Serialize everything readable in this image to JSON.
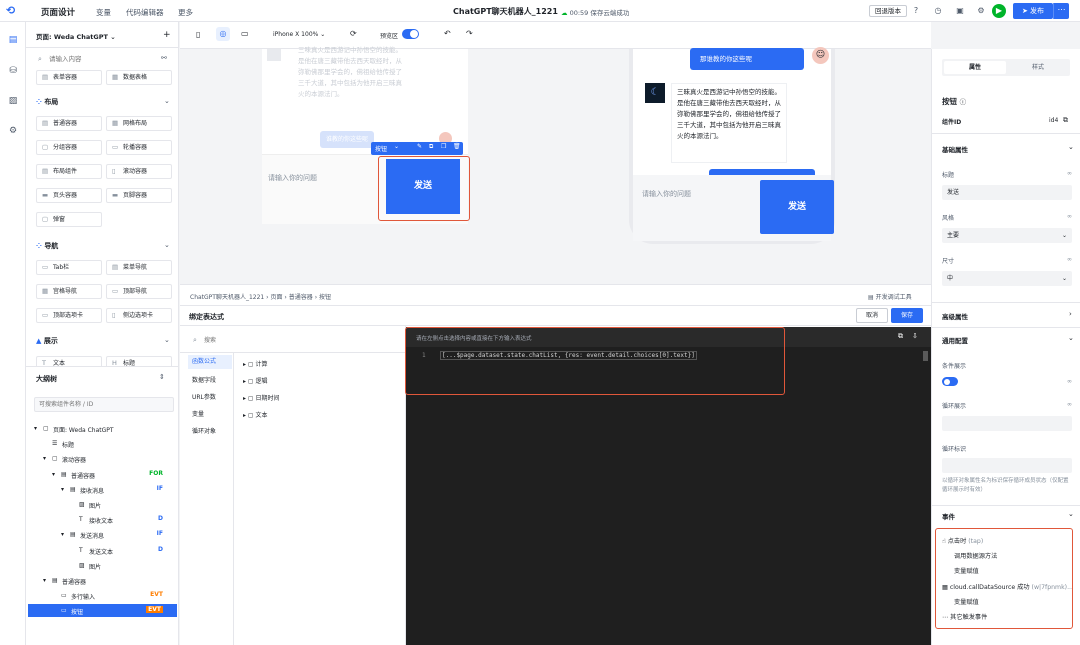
{
  "topbar": {
    "title": "页面设计",
    "nav": [
      "变量",
      "代码编辑器",
      "更多"
    ],
    "doc_title": "ChatGPT聊天机器人_1221",
    "save_status": "00:59 保存云端成功",
    "rollback": "回退版本",
    "publish": "发布"
  },
  "left": {
    "page_select": "页面: Weda ChatGPT",
    "search_placeholder": "请输入内容",
    "group_top": {
      "a": "表单容器",
      "b": "数据表格"
    },
    "layout_title": "布局",
    "layout_items": [
      "普通容器",
      "网格布局",
      "分组容器",
      "轮播容器",
      "布局组件",
      "滚动容器",
      "页头容器",
      "页脚容器",
      "弹窗"
    ],
    "nav_title": "导航",
    "nav_items": [
      "Tab栏",
      "菜单导航",
      "宫格导航",
      "顶部导航",
      "顶部选项卡",
      "侧边选项卡"
    ],
    "display_title": "展示",
    "display_items": [
      "文本",
      "标题"
    ],
    "outline_title": "大纲树",
    "outline_placeholder": "可搜索组件名称 / ID",
    "tree": [
      {
        "label": "页面: Weda ChatGPT",
        "tag": ""
      },
      {
        "label": "标题",
        "tag": ""
      },
      {
        "label": "滚动容器",
        "tag": ""
      },
      {
        "label": "普通容器",
        "tag": "FOR"
      },
      {
        "label": "接收消息",
        "tag": "IF"
      },
      {
        "label": "图片",
        "tag": ""
      },
      {
        "label": "接收文本",
        "tag": "D"
      },
      {
        "label": "发送消息",
        "tag": "IF"
      },
      {
        "label": "发送文本",
        "tag": "D"
      },
      {
        "label": "图片",
        "tag": ""
      },
      {
        "label": "普通容器",
        "tag": ""
      },
      {
        "label": "多行输入",
        "tag": "EVT"
      },
      {
        "label": "按钮",
        "tag": "EVT"
      }
    ]
  },
  "canvas": {
    "device": "iPhone X 100%",
    "preview": "预览区",
    "faded_text": "三味真火是西游记中孙悟空的技能。是他在唐三藏带他去西天取经时，从弥勒佛那里学会的，佛祖给他传授了三千大道，其中包括为他开启三昧真火的本源法门。",
    "faded_bubble": "谁教的你这些呢",
    "btn_label": "按钮",
    "input_placeholder": "请输入你的问题",
    "send_label": "发送",
    "phone_question": "那谁教的你这些呢",
    "phone_answer": "三昧真火是西游记中孙悟空的技能。是他在唐三藏带他去西天取经时，从弥勒佛那里学会的，佛祖给他传授了三千大道，其中包括为他开启三昧真火的本源法门。",
    "phone_placeholder": "请输入你的问题",
    "phone_send": "发送"
  },
  "breadcrumb": {
    "items": [
      "ChatGPT聊天机器人_1221",
      "页面",
      "普通容器",
      "按钮"
    ],
    "devtools": "开发调试工具"
  },
  "bind": {
    "title": "绑定表达式",
    "cancel": "取消",
    "save": "保存",
    "search_placeholder": "搜索",
    "categories": [
      "函数公式",
      "数据字段",
      "URL参数",
      "变量",
      "循环对象"
    ],
    "folders": [
      "计算",
      "逻辑",
      "日期时间",
      "文本"
    ],
    "editor_hint": "请在左侧点击选择内容或直接在下方输入表达式",
    "line_no": "1",
    "code": "[...$page.dataset.state.chatList, {res: event.detail.choices[0].text}]"
  },
  "right": {
    "tabs": [
      "属性",
      "样式"
    ],
    "comp_title": "按钮",
    "id_label": "组件ID",
    "id_value": "id4",
    "basic": "基础属性",
    "title_label": "标题",
    "title_value": "发送",
    "style_label": "风格",
    "style_value": "主要",
    "size_label": "尺寸",
    "size_value": "中",
    "advanced": "高级属性",
    "general": "通用配置",
    "cond": "条件展示",
    "loop": "循环展示",
    "loop_key": "循环标识",
    "loop_hint": "以循环对象属性名为标识保存循环成员状态（仅配置循环展示时有效）",
    "events": "事件",
    "event_tap": "点击时",
    "event_tap_sub": "(tap)",
    "ev1": "调用数据源方法",
    "ev2": "变量赋值",
    "ev_cloud": "cloud.callDataSource 成功",
    "ev_cloud_sub": "(w|7fpnmk)...",
    "ev3": "变量赋值",
    "ev_other": "其它触发事件"
  }
}
